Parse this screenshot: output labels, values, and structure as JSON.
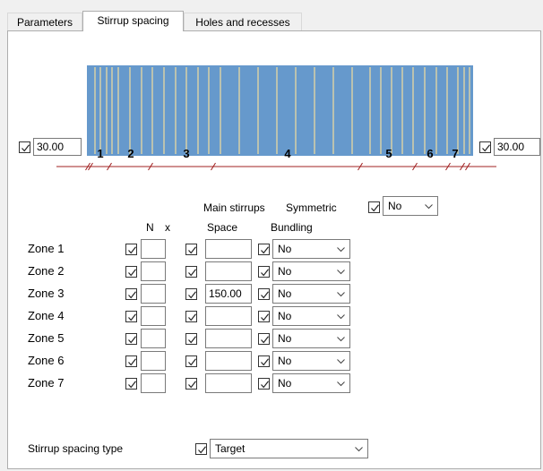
{
  "tabs": [
    {
      "label": "Parameters"
    },
    {
      "label": "Stirrup spacing"
    },
    {
      "label": "Holes and recesses"
    }
  ],
  "beam": {
    "left_cover": "30.00",
    "right_cover": "30.00",
    "zone_numbers": [
      "1",
      "2",
      "3",
      "4",
      "5",
      "6",
      "7"
    ],
    "fill_color": "#6699cc",
    "stirrup_color": "#e8d8a0",
    "dimension_line_color": "#a02020"
  },
  "headers": {
    "main_stirrups": "Main stirrups",
    "symmetric": "Symmetric",
    "symmetric_value": "No",
    "n": "N",
    "x": "x",
    "space": "Space",
    "bundling": "Bundling"
  },
  "zones": [
    {
      "label": "Zone 1",
      "n": "",
      "space": "",
      "bundling": "No"
    },
    {
      "label": "Zone 2",
      "n": "",
      "space": "",
      "bundling": "No"
    },
    {
      "label": "Zone 3",
      "n": "",
      "space": "150.00",
      "bundling": "No"
    },
    {
      "label": "Zone 4",
      "n": "",
      "space": "",
      "bundling": "No"
    },
    {
      "label": "Zone 5",
      "n": "",
      "space": "",
      "bundling": "No"
    },
    {
      "label": "Zone 6",
      "n": "",
      "space": "",
      "bundling": "No"
    },
    {
      "label": "Zone 7",
      "n": "",
      "space": "",
      "bundling": "No"
    }
  ],
  "spacing_type": {
    "label": "Stirrup spacing type",
    "value": "Target"
  }
}
